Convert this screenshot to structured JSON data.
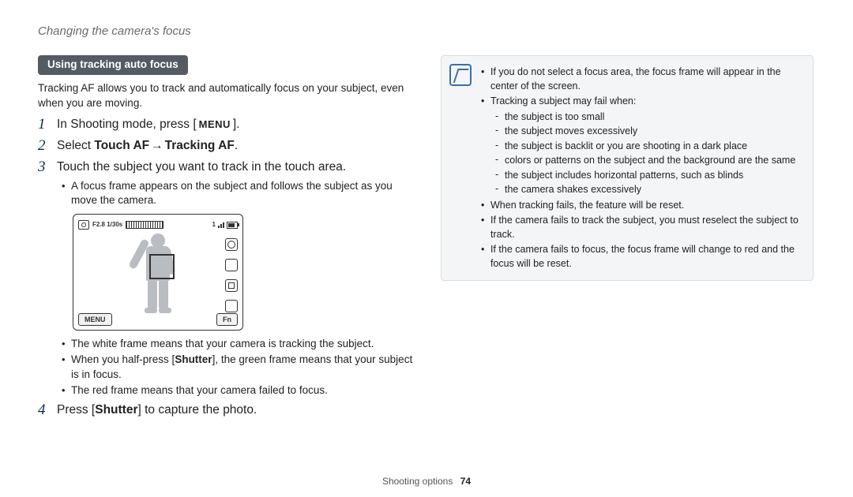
{
  "header": {
    "title": "Changing the camera's focus"
  },
  "left": {
    "section_label": "Using tracking auto focus",
    "intro": "Tracking AF allows you to track and automatically focus on your subject, even when you are moving.",
    "steps": {
      "s1_a": "In Shooting mode, press [",
      "s1_menu": "MENU",
      "s1_b": "].",
      "s2_a": "Select ",
      "s2_touch": "Touch AF",
      "s2_arrow": " → ",
      "s2_track": "Tracking AF",
      "s2_end": ".",
      "s3": "Touch the subject you want to track in the touch area.",
      "s3_sub1": "A focus frame appears on the subject and follows the subject as you move the camera.",
      "s3_sub2": "The white frame means that your camera is tracking the subject.",
      "s3_sub3a": "When you half-press [",
      "s3_sub3_shutter": "Shutter",
      "s3_sub3b": "], the green frame means that your subject is in focus.",
      "s3_sub4": "The red frame means that your camera failed to focus.",
      "s4a": "Press [",
      "s4_shutter": "Shutter",
      "s4b": "] to capture the photo."
    },
    "cam": {
      "fstop": "F2.8 1/30s",
      "count": "1",
      "menu": "MENU",
      "fn": "Fn"
    }
  },
  "note": {
    "b1": "If you do not select a focus area, the focus frame will appear in the center of the screen.",
    "b2": "Tracking a subject may fail when:",
    "b2_1": "the subject is too small",
    "b2_2": "the subject moves excessively",
    "b2_3": "the subject is backlit or you are shooting in a dark place",
    "b2_4": "colors or patterns on the subject and the background are the same",
    "b2_5": "the subject includes horizontal patterns, such as blinds",
    "b2_6": "the camera shakes excessively",
    "b3": "When tracking fails, the feature will be reset.",
    "b4": "If the camera fails to track the subject, you must reselect the subject to track.",
    "b5": "If the camera fails to focus, the focus frame will change to red and the focus will be reset."
  },
  "footer": {
    "section": "Shooting options",
    "page": "74"
  }
}
